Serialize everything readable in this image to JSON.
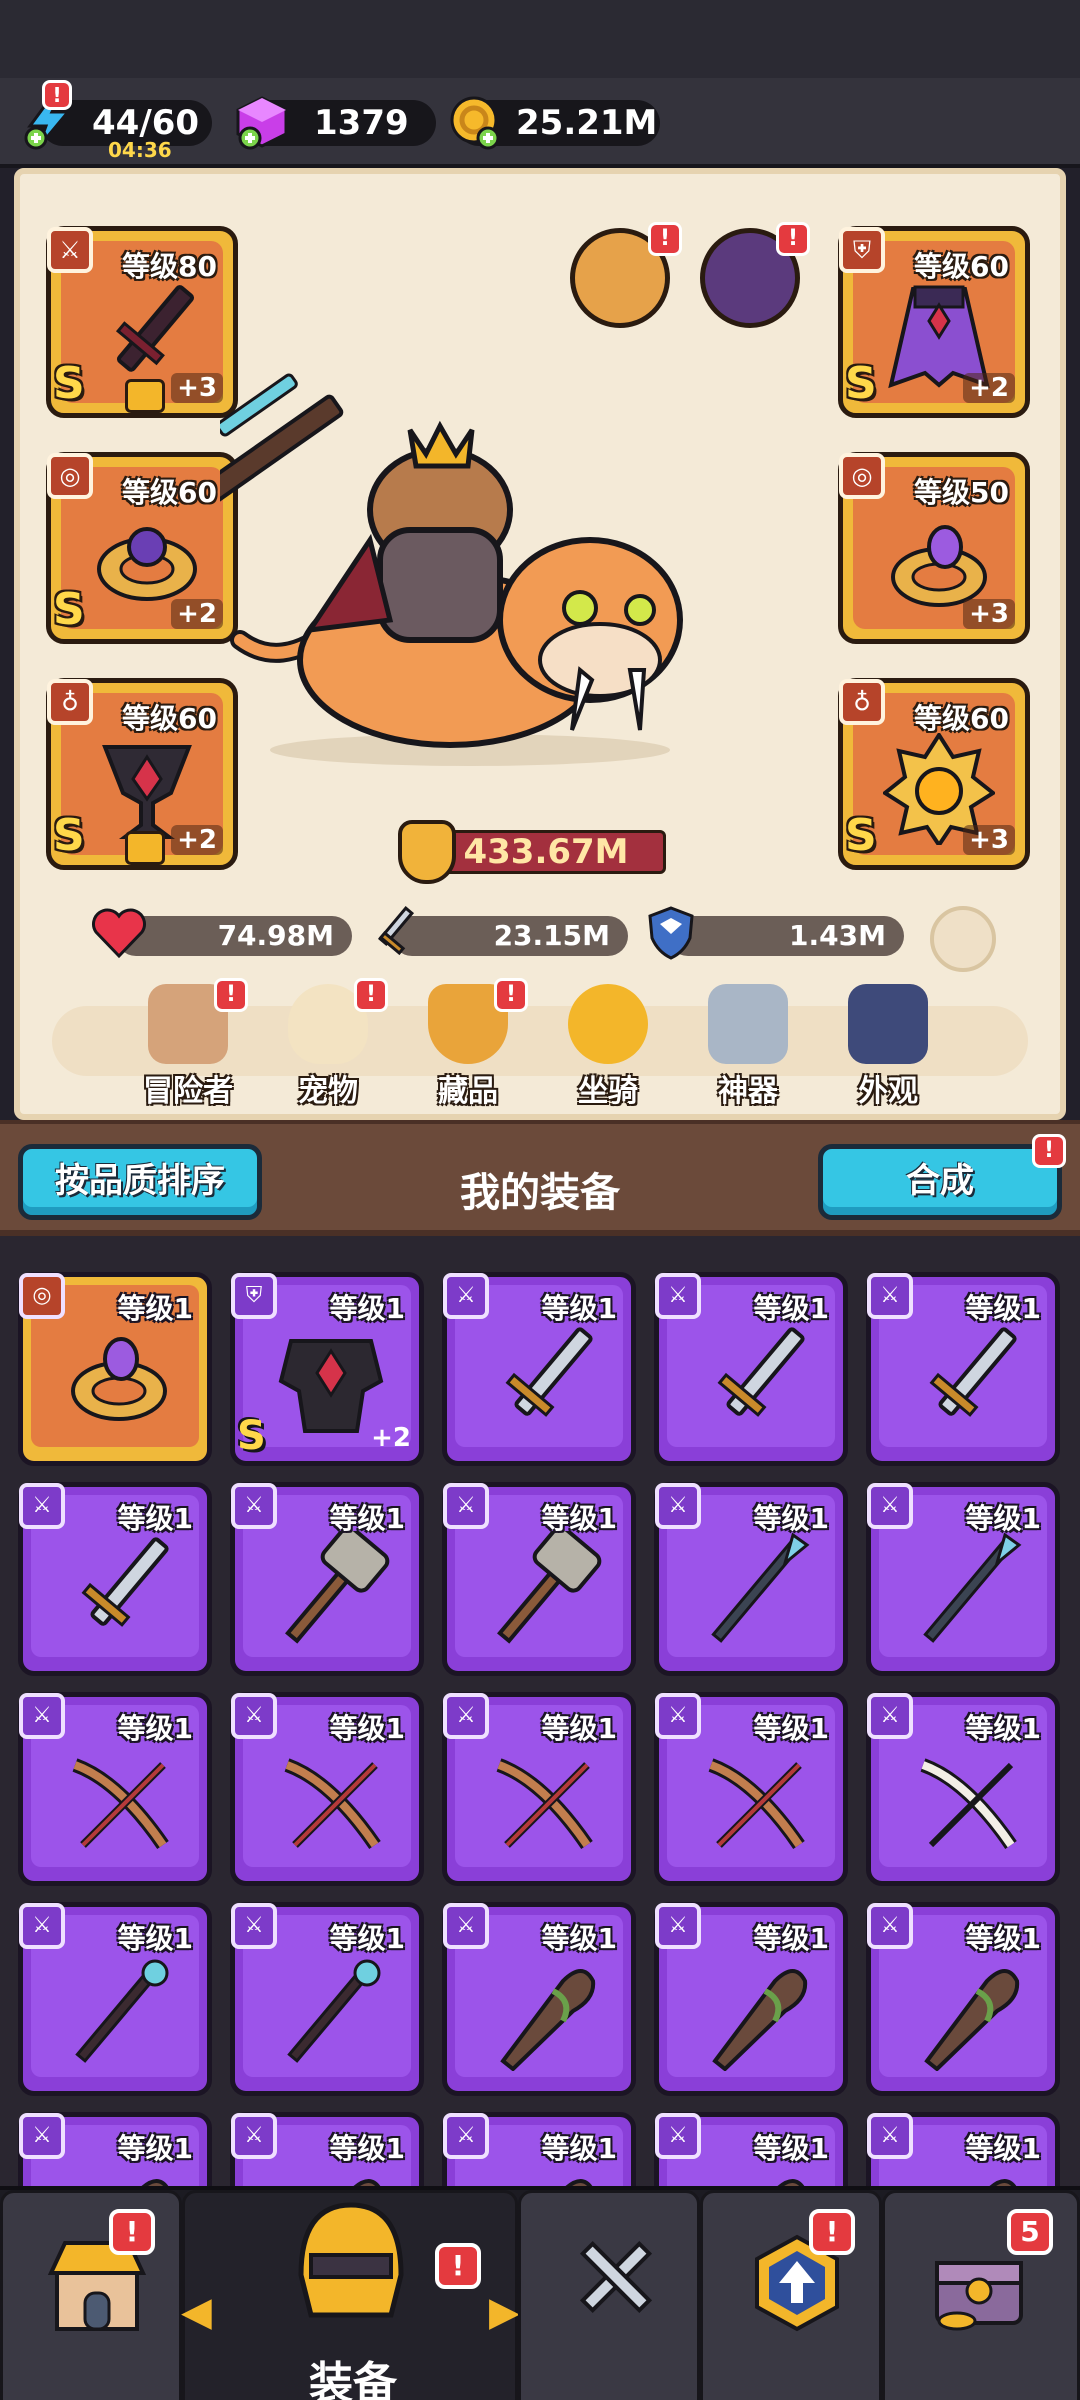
{
  "currency": {
    "energy_value": "44/60",
    "energy_timer": "04:36",
    "gems_value": "1379",
    "gold_value": "25.21M"
  },
  "equipment_slots": {
    "weapon": {
      "level": "等级80",
      "grade": "S",
      "plus": "+3"
    },
    "ring": {
      "level": "等级60",
      "grade": "S",
      "plus": "+2"
    },
    "necklace": {
      "level": "等级60",
      "grade": "S",
      "plus": "+2"
    },
    "armor": {
      "level": "等级60",
      "grade": "S",
      "plus": "+2"
    },
    "ring2": {
      "level": "等级50",
      "grade": "",
      "plus": "+3"
    },
    "amulet": {
      "level": "等级60",
      "grade": "S",
      "plus": "+3"
    }
  },
  "character": {
    "power": "433.67M",
    "hp": "74.98M",
    "attack": "23.15M",
    "defense": "1.43M"
  },
  "nav_tabs": [
    {
      "label": "冒险者",
      "badge": "!"
    },
    {
      "label": "宠物",
      "badge": "!"
    },
    {
      "label": "藏品",
      "badge": "!"
    },
    {
      "label": "坐骑",
      "badge": ""
    },
    {
      "label": "神器",
      "badge": ""
    },
    {
      "label": "外观",
      "badge": ""
    }
  ],
  "equipment_header": {
    "sort_button": "按品质排序",
    "title": "我的装备",
    "combine_button": "合成",
    "combine_badge": "!"
  },
  "inventory": [
    {
      "level": "等级1",
      "type": "ring",
      "rarity": "orange",
      "grade": "",
      "plus": ""
    },
    {
      "level": "等级1",
      "type": "armor",
      "rarity": "purple",
      "grade": "S",
      "plus": "+2"
    },
    {
      "level": "等级1",
      "type": "sword",
      "rarity": "purple",
      "grade": "",
      "plus": ""
    },
    {
      "level": "等级1",
      "type": "sword",
      "rarity": "purple",
      "grade": "",
      "plus": ""
    },
    {
      "level": "等级1",
      "type": "sword",
      "rarity": "purple",
      "grade": "",
      "plus": ""
    },
    {
      "level": "等级1",
      "type": "sword",
      "rarity": "purple",
      "grade": "",
      "plus": ""
    },
    {
      "level": "等级1",
      "type": "hammer",
      "rarity": "purple",
      "grade": "",
      "plus": ""
    },
    {
      "level": "等级1",
      "type": "hammer",
      "rarity": "purple",
      "grade": "",
      "plus": ""
    },
    {
      "level": "等级1",
      "type": "spear",
      "rarity": "purple",
      "grade": "",
      "plus": ""
    },
    {
      "level": "等级1",
      "type": "spear",
      "rarity": "purple",
      "grade": "",
      "plus": ""
    },
    {
      "level": "等级1",
      "type": "bow",
      "rarity": "purple",
      "grade": "",
      "plus": ""
    },
    {
      "level": "等级1",
      "type": "bow",
      "rarity": "purple",
      "grade": "",
      "plus": ""
    },
    {
      "level": "等级1",
      "type": "bow",
      "rarity": "purple",
      "grade": "",
      "plus": ""
    },
    {
      "level": "等级1",
      "type": "bow",
      "rarity": "purple",
      "grade": "",
      "plus": ""
    },
    {
      "level": "等级1",
      "type": "bone-bow",
      "rarity": "purple",
      "grade": "",
      "plus": ""
    },
    {
      "level": "等级1",
      "type": "staff",
      "rarity": "purple",
      "grade": "",
      "plus": ""
    },
    {
      "level": "等级1",
      "type": "staff",
      "rarity": "purple",
      "grade": "",
      "plus": ""
    },
    {
      "level": "等级1",
      "type": "club",
      "rarity": "purple",
      "grade": "",
      "plus": ""
    },
    {
      "level": "等级1",
      "type": "club",
      "rarity": "purple",
      "grade": "",
      "plus": ""
    },
    {
      "level": "等级1",
      "type": "club",
      "rarity": "purple",
      "grade": "",
      "plus": ""
    },
    {
      "level": "等级1",
      "type": "club",
      "rarity": "purple",
      "grade": "",
      "plus": ""
    },
    {
      "level": "等级1",
      "type": "club",
      "rarity": "purple",
      "grade": "",
      "plus": ""
    },
    {
      "level": "等级1",
      "type": "club",
      "rarity": "purple",
      "grade": "",
      "plus": ""
    },
    {
      "level": "等级1",
      "type": "club",
      "rarity": "purple",
      "grade": "",
      "plus": ""
    },
    {
      "level": "等级1",
      "type": "club",
      "rarity": "purple",
      "grade": "",
      "plus": ""
    }
  ],
  "bottom_nav": {
    "active_label": "装备",
    "shop_badge": "!",
    "equipment_badge": "!",
    "upgrade_badge": "!",
    "chest_badge": "5"
  }
}
